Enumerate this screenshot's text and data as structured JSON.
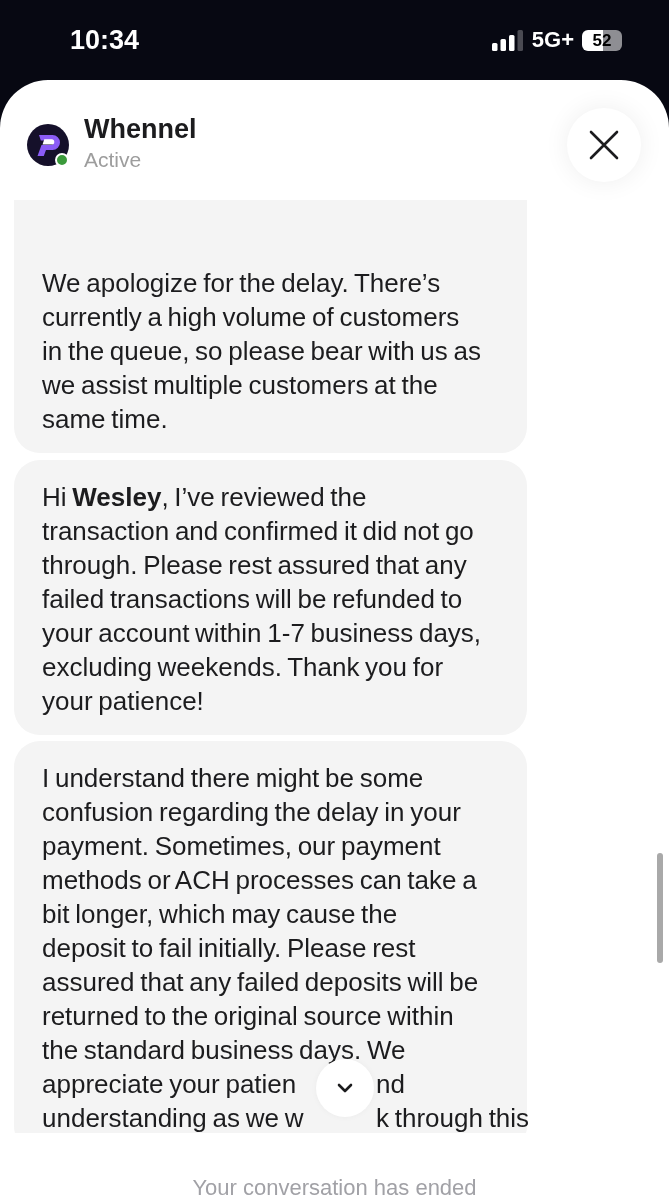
{
  "status_bar": {
    "time": "10:34",
    "network": "5G+",
    "battery": "52"
  },
  "header": {
    "name": "Whennel",
    "status": "Active",
    "online": true
  },
  "messages": [
    {
      "text": "We apologize for the delay. There’s currently a high volume of customers in the queue, so please bear with us as we assist multiple customers at the same time."
    },
    {
      "text": "Hi **Wesley**, I’ve reviewed the transaction and confirmed it did not go through. Please rest assured that any failed transactions will be refunded to your account within 1-7 business days, excluding weekends. Thank you for your patience!"
    },
    {
      "text": "I understand there might be some confusion regarding the delay in your payment. Sometimes, our payment methods or ACH processes can take a bit longer, which may cause the deposit to fail initially. Please rest assured that any failed deposits will be returned to the original source within the standard business days. We",
      "lines_under_scroll_button": [
        [
          "appreciate your patien",
          "nd"
        ],
        [
          "understanding as we w",
          "k through this"
        ]
      ]
    }
  ],
  "footer": {
    "notice": "Your conversation has ended"
  }
}
